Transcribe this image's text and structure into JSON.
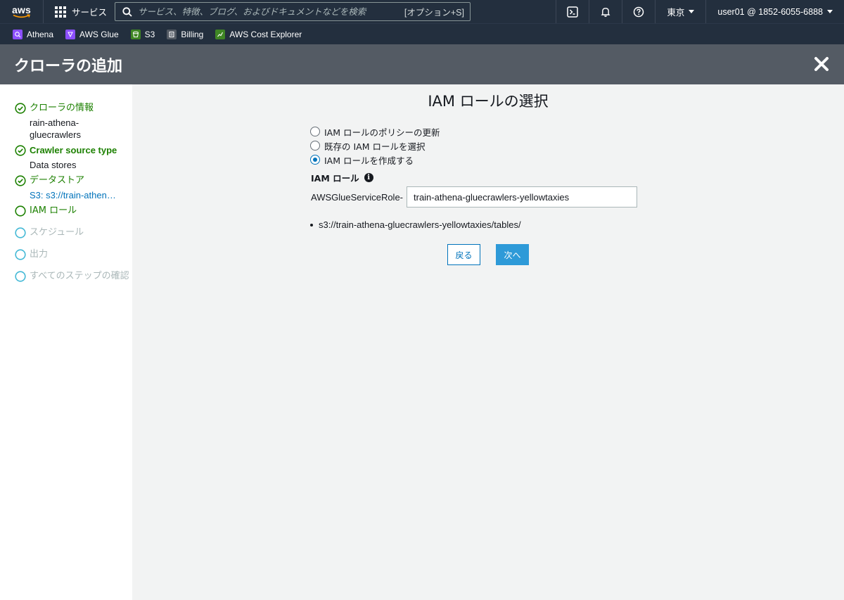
{
  "topnav": {
    "logo_text": "aws",
    "services_label": "サービス",
    "search_placeholder": "サービス、特徴、ブログ、およびドキュメントなどを検索",
    "search_shortcut": "[オプション+S]",
    "region_label": "東京",
    "account_label": "user01 @ 1852-6055-6888"
  },
  "favorites": [
    {
      "label": "Athena",
      "color": "#8c4fff"
    },
    {
      "label": "AWS Glue",
      "color": "#8c4fff"
    },
    {
      "label": "S3",
      "color": "#3f8624"
    },
    {
      "label": "Billing",
      "color": "#545b64"
    },
    {
      "label": "AWS Cost Explorer",
      "color": "#3f8624"
    }
  ],
  "header": {
    "title": "クローラの追加"
  },
  "steps": [
    {
      "title": "クローラの情報",
      "sub": "rain-athena-gluecrawlers",
      "state": "done"
    },
    {
      "title": "Crawler source type",
      "sub": "Data stores",
      "state": "done"
    },
    {
      "title": "データストア",
      "sub": "S3: s3://train-athen…",
      "state": "done"
    },
    {
      "title": "IAM ロール",
      "sub": "",
      "state": "current"
    },
    {
      "title": "スケジュール",
      "sub": "",
      "state": "pending"
    },
    {
      "title": "出力",
      "sub": "",
      "state": "pending"
    },
    {
      "title": "すべてのステップの確認",
      "sub": "",
      "state": "pending"
    }
  ],
  "main": {
    "title": "IAM ロールの選択",
    "options": [
      {
        "label": "IAM ロールのポリシーの更新",
        "checked": false
      },
      {
        "label": "既存の IAM ロールを選択",
        "checked": false
      },
      {
        "label": "IAM ロールを作成する",
        "checked": true
      }
    ],
    "role_label": "IAM ロール",
    "role_prefix": "AWSGlueServiceRole-",
    "role_value": "train-athena-gluecrawlers-yellowtaxies",
    "s3_paths": [
      "s3://train-athena-gluecrawlers-yellowtaxies/tables/"
    ],
    "back_label": "戻る",
    "next_label": "次へ"
  },
  "colors": {
    "nav_bg": "#232f3e",
    "header_bg": "#545b64",
    "success": "#1d8102",
    "pending": "#aab7b8",
    "link": "#0073bb",
    "primary_button": "#2e9ad8"
  }
}
